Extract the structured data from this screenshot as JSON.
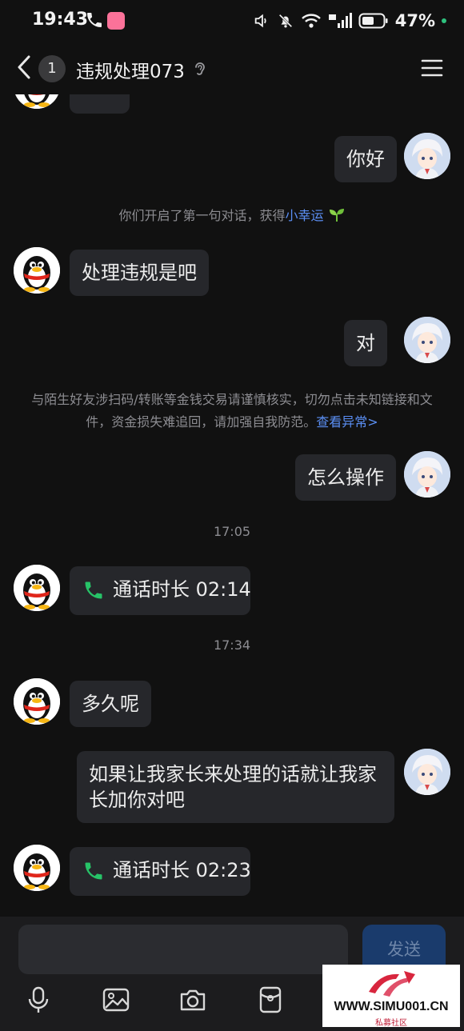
{
  "status_bar": {
    "time": "19:43",
    "battery": "47%"
  },
  "nav": {
    "unread_count": "1",
    "title": "违规处理073"
  },
  "messages": {
    "m0": "你好",
    "sys1_prefix": "你们开启了第一句对话，获得",
    "sys1_link": "小幸运",
    "m1": "处理违规是吧",
    "m2": "对",
    "warn_text": "与陌生好友涉扫码/转账等金钱交易请谨慎核实，切勿点击未知链接和文件，资金损失难追回，请加强自我防范。",
    "warn_link": "查看异常>",
    "m3": "怎么操作",
    "ts1": "17:05",
    "call1": "通话时长 02:14",
    "ts2": "17:34",
    "m4": "多久呢",
    "m5": "如果让我家长来处理的话就让我家长加你对吧",
    "call2": "通话时长 02:23"
  },
  "input": {
    "send_label": "发送"
  },
  "watermark": {
    "text": "WWW.SIMU001.CN",
    "sub": "私募社区"
  },
  "colors": {
    "background": "#111111",
    "bubble": "#26272b",
    "link": "#5b8ff4",
    "call_green": "#27c368",
    "send_button": "#1a3b6c"
  }
}
